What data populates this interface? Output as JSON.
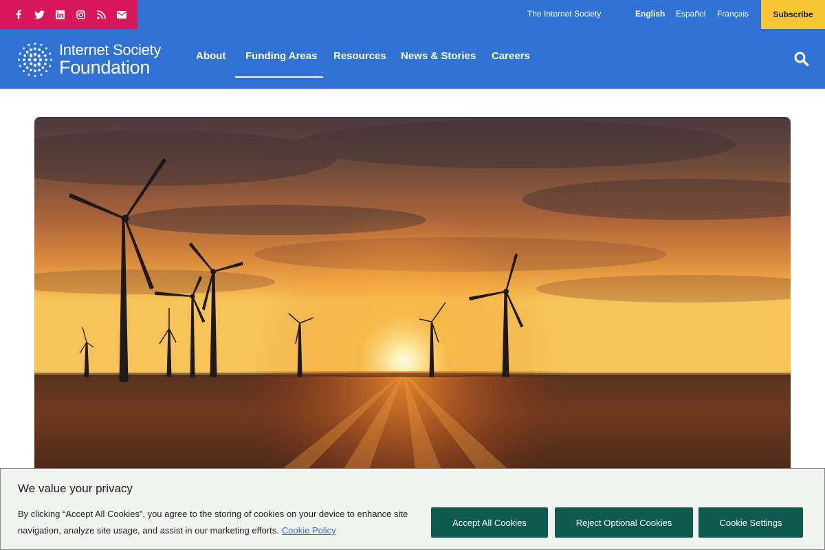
{
  "social": {
    "icons": [
      "facebook-icon",
      "twitter-icon",
      "linkedin-icon",
      "instagram-icon",
      "rss-icon",
      "email-icon"
    ],
    "background": "#d8175d"
  },
  "utility": {
    "org_link": "The Internet Society",
    "languages": [
      "English",
      "Español",
      "Français"
    ],
    "active_language": "English",
    "subscribe_label": "Subscribe"
  },
  "brand": {
    "line1": "Internet Society",
    "line2": "Foundation"
  },
  "nav": {
    "items": [
      "About",
      "Funding Areas",
      "Resources",
      "News & Stories",
      "Careers"
    ],
    "active": "Funding Areas",
    "search_icon": "search-icon"
  },
  "hero": {
    "image": "sunset-wind-turbines-field"
  },
  "cookie": {
    "title": "We value your privacy",
    "text": "By clicking “Accept All Cookies”, you agree to the storing of cookies on your device to enhance site navigation, analyze site usage, and assist in our marketing efforts.",
    "policy_link": "Cookie Policy",
    "accept_label": "Accept All Cookies",
    "reject_label": "Reject Optional Cookies",
    "settings_label": "Cookie Settings"
  },
  "colors": {
    "primary_blue": "#2f72d4",
    "accent_yellow": "#f8c534",
    "cookie_button": "#0d5a4e"
  }
}
